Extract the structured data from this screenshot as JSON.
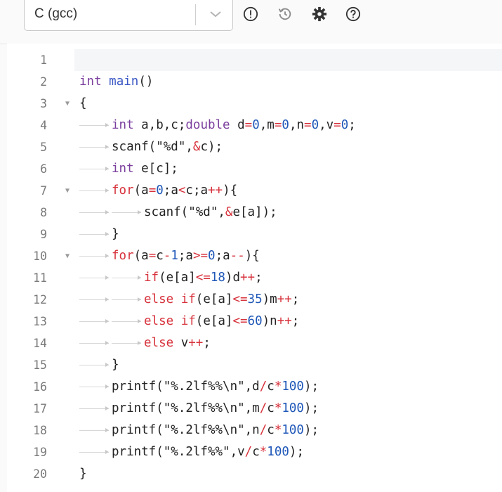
{
  "toolbar": {
    "language": "C (gcc)",
    "icons": [
      "alert-circle-icon",
      "history-icon",
      "gear-icon",
      "help-icon"
    ]
  },
  "editor": {
    "lines": [
      {
        "n": "1",
        "indent": 0,
        "fold": false,
        "tokens": []
      },
      {
        "n": "2",
        "indent": 0,
        "fold": false,
        "tokens": [
          [
            "kw",
            "int"
          ],
          [
            "plain",
            " "
          ],
          [
            "fn",
            "main"
          ],
          [
            "plain",
            "()"
          ]
        ]
      },
      {
        "n": "3",
        "indent": 0,
        "fold": true,
        "tokens": [
          [
            "plain",
            "{"
          ]
        ]
      },
      {
        "n": "4",
        "indent": 1,
        "fold": false,
        "tokens": [
          [
            "kw",
            "int"
          ],
          [
            "plain",
            " a,b,c;"
          ],
          [
            "kw",
            "double"
          ],
          [
            "plain",
            " d"
          ],
          [
            "op",
            "="
          ],
          [
            "num",
            "0"
          ],
          [
            "plain",
            ",m"
          ],
          [
            "op",
            "="
          ],
          [
            "num",
            "0"
          ],
          [
            "plain",
            ",n"
          ],
          [
            "op",
            "="
          ],
          [
            "num",
            "0"
          ],
          [
            "plain",
            ",v"
          ],
          [
            "op",
            "="
          ],
          [
            "num",
            "0"
          ],
          [
            "plain",
            ";"
          ]
        ]
      },
      {
        "n": "5",
        "indent": 1,
        "fold": false,
        "tokens": [
          [
            "plain",
            "scanf(\"%d\","
          ],
          [
            "op",
            "&"
          ],
          [
            "plain",
            "c);"
          ]
        ]
      },
      {
        "n": "6",
        "indent": 1,
        "fold": false,
        "tokens": [
          [
            "kw",
            "int"
          ],
          [
            "plain",
            " e[c];"
          ]
        ]
      },
      {
        "n": "7",
        "indent": 1,
        "fold": true,
        "tokens": [
          [
            "ctl",
            "for"
          ],
          [
            "plain",
            "(a"
          ],
          [
            "op",
            "="
          ],
          [
            "num",
            "0"
          ],
          [
            "plain",
            ";a"
          ],
          [
            "op",
            "<"
          ],
          [
            "plain",
            "c;a"
          ],
          [
            "op",
            "++"
          ],
          [
            "plain",
            "){"
          ]
        ]
      },
      {
        "n": "8",
        "indent": 2,
        "fold": false,
        "tokens": [
          [
            "plain",
            "scanf(\"%d\","
          ],
          [
            "op",
            "&"
          ],
          [
            "plain",
            "e[a]);"
          ]
        ]
      },
      {
        "n": "9",
        "indent": 1,
        "fold": false,
        "tokens": [
          [
            "plain",
            "}"
          ]
        ]
      },
      {
        "n": "10",
        "indent": 1,
        "fold": true,
        "tokens": [
          [
            "ctl",
            "for"
          ],
          [
            "plain",
            "(a"
          ],
          [
            "op",
            "="
          ],
          [
            "plain",
            "c"
          ],
          [
            "op",
            "-"
          ],
          [
            "num",
            "1"
          ],
          [
            "plain",
            ";a"
          ],
          [
            "op",
            ">="
          ],
          [
            "num",
            "0"
          ],
          [
            "plain",
            ";a"
          ],
          [
            "op",
            "--"
          ],
          [
            "plain",
            "){"
          ]
        ]
      },
      {
        "n": "11",
        "indent": 2,
        "fold": false,
        "tokens": [
          [
            "ctl",
            "if"
          ],
          [
            "plain",
            "(e[a]"
          ],
          [
            "op",
            "<="
          ],
          [
            "num",
            "18"
          ],
          [
            "plain",
            ")d"
          ],
          [
            "op",
            "++"
          ],
          [
            "plain",
            ";"
          ]
        ]
      },
      {
        "n": "12",
        "indent": 2,
        "fold": false,
        "tokens": [
          [
            "ctl",
            "else"
          ],
          [
            "plain",
            " "
          ],
          [
            "ctl",
            "if"
          ],
          [
            "plain",
            "(e[a]"
          ],
          [
            "op",
            "<="
          ],
          [
            "num",
            "35"
          ],
          [
            "plain",
            ")m"
          ],
          [
            "op",
            "++"
          ],
          [
            "plain",
            ";"
          ]
        ]
      },
      {
        "n": "13",
        "indent": 2,
        "fold": false,
        "tokens": [
          [
            "ctl",
            "else"
          ],
          [
            "plain",
            " "
          ],
          [
            "ctl",
            "if"
          ],
          [
            "plain",
            "(e[a]"
          ],
          [
            "op",
            "<="
          ],
          [
            "num",
            "60"
          ],
          [
            "plain",
            ")n"
          ],
          [
            "op",
            "++"
          ],
          [
            "plain",
            ";"
          ]
        ]
      },
      {
        "n": "14",
        "indent": 2,
        "fold": false,
        "tokens": [
          [
            "ctl",
            "else"
          ],
          [
            "plain",
            " v"
          ],
          [
            "op",
            "++"
          ],
          [
            "plain",
            ";"
          ]
        ]
      },
      {
        "n": "15",
        "indent": 1,
        "fold": false,
        "tokens": [
          [
            "plain",
            "}"
          ]
        ]
      },
      {
        "n": "16",
        "indent": 1,
        "fold": false,
        "tokens": [
          [
            "plain",
            "printf(\"%.2lf%%\\n\",d"
          ],
          [
            "op",
            "/"
          ],
          [
            "plain",
            "c"
          ],
          [
            "op",
            "*"
          ],
          [
            "num",
            "100"
          ],
          [
            "plain",
            ");"
          ]
        ]
      },
      {
        "n": "17",
        "indent": 1,
        "fold": false,
        "tokens": [
          [
            "plain",
            "printf(\"%.2lf%%\\n\",m"
          ],
          [
            "op",
            "/"
          ],
          [
            "plain",
            "c"
          ],
          [
            "op",
            "*"
          ],
          [
            "num",
            "100"
          ],
          [
            "plain",
            ");"
          ]
        ]
      },
      {
        "n": "18",
        "indent": 1,
        "fold": false,
        "tokens": [
          [
            "plain",
            "printf(\"%.2lf%%\\n\",n"
          ],
          [
            "op",
            "/"
          ],
          [
            "plain",
            "c"
          ],
          [
            "op",
            "*"
          ],
          [
            "num",
            "100"
          ],
          [
            "plain",
            ");"
          ]
        ]
      },
      {
        "n": "19",
        "indent": 1,
        "fold": false,
        "tokens": [
          [
            "plain",
            "printf(\"%.2lf%%\",v"
          ],
          [
            "op",
            "/"
          ],
          [
            "plain",
            "c"
          ],
          [
            "op",
            "*"
          ],
          [
            "num",
            "100"
          ],
          [
            "plain",
            ");"
          ]
        ]
      },
      {
        "n": "20",
        "indent": 0,
        "fold": false,
        "tokens": [
          [
            "plain",
            "}"
          ]
        ]
      }
    ]
  }
}
